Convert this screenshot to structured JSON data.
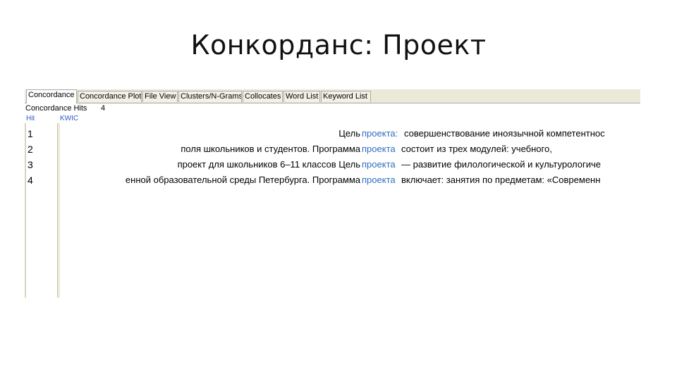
{
  "slide": {
    "title": "Конкорданс: Проект"
  },
  "tabs": [
    {
      "label": "Concordance",
      "active": true
    },
    {
      "label": "Concordance Plot",
      "active": false
    },
    {
      "label": "File View",
      "active": false
    },
    {
      "label": "Clusters/N-Grams",
      "active": false
    },
    {
      "label": "Collocates",
      "active": false
    },
    {
      "label": "Word List",
      "active": false
    },
    {
      "label": "Keyword List",
      "active": false
    }
  ],
  "concordance": {
    "hits_label": "Concordance Hits",
    "hits_count": "4",
    "columns": {
      "hit": "Hit",
      "kwic": "KWIC"
    },
    "rows": [
      {
        "hit": "1",
        "left": "Цель",
        "keyword": "проекта:",
        "right": "совершенствование иноязычной компетентнос"
      },
      {
        "hit": "2",
        "left": "поля школьников и студентов. Программа",
        "keyword": "проекта",
        "right": "состоит из трех модулей: учебного,"
      },
      {
        "hit": "3",
        "left": "проект для школьников 6–11 классов Цель",
        "keyword": "проекта",
        "right": "— развитие филологической и культурологиче"
      },
      {
        "hit": "4",
        "left": "енной образовательной среды Петербурга. Программа",
        "keyword": "проекта",
        "right": "включает: занятия по предметам: «Современн"
      }
    ]
  },
  "colors": {
    "keyword": "#2e6fbf",
    "header": "#2b57c4",
    "chrome": "#ece9d8"
  }
}
